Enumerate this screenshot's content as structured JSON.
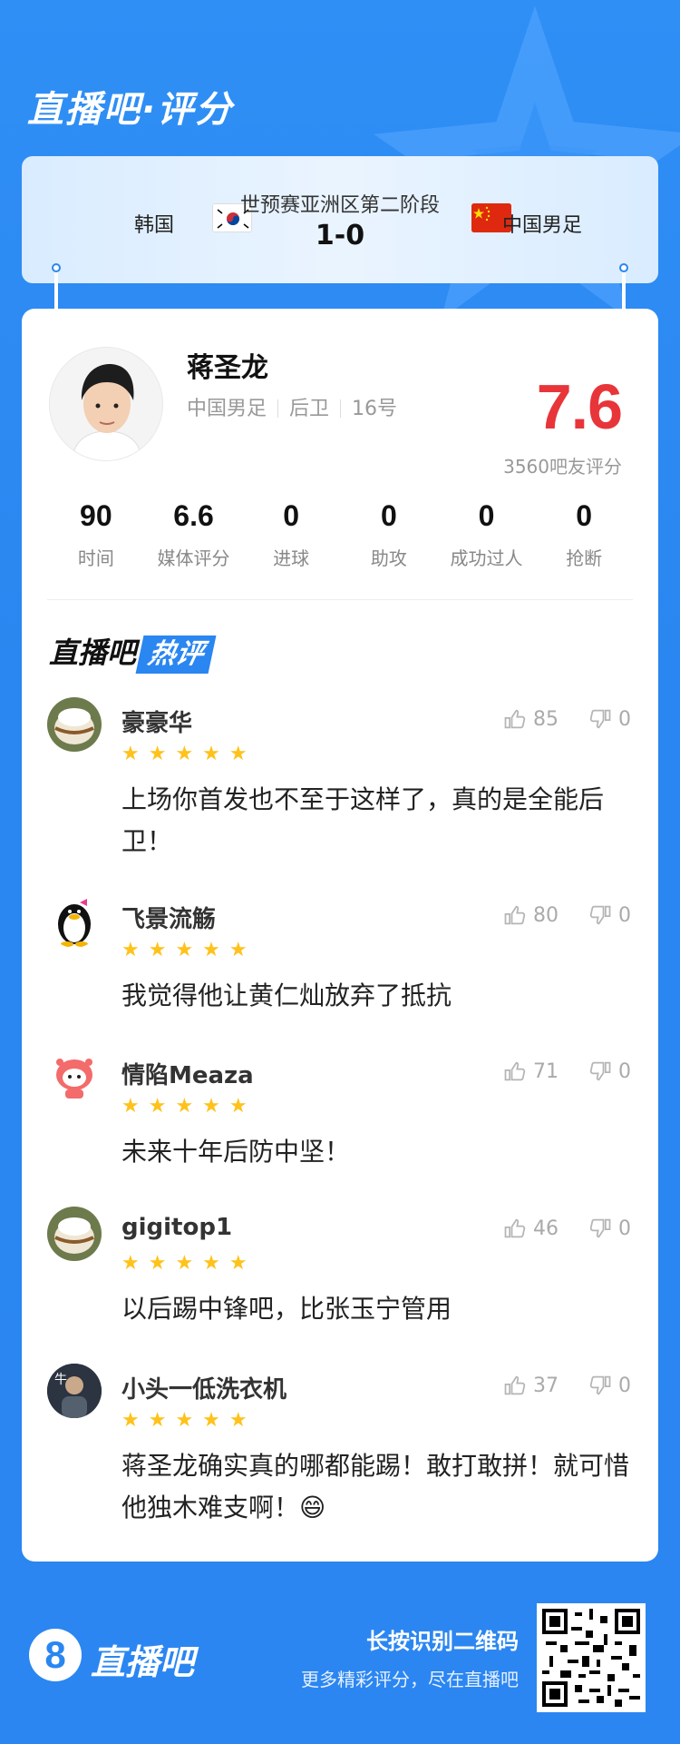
{
  "page": {
    "title": "直播吧·评分"
  },
  "match": {
    "stage": "世预赛亚洲区第二阶段",
    "score": "1-0",
    "home_team": "韩国",
    "away_team": "中国男足"
  },
  "player": {
    "name": "蒋圣龙",
    "team": "中国男足",
    "position": "后卫",
    "number": "16号",
    "rating": "7.6",
    "rating_count": "3560吧友评分"
  },
  "stats": [
    {
      "value": "90",
      "label": "时间"
    },
    {
      "value": "6.6",
      "label": "媒体评分"
    },
    {
      "value": "0",
      "label": "进球"
    },
    {
      "value": "0",
      "label": "助攻"
    },
    {
      "value": "0",
      "label": "成功过人"
    },
    {
      "value": "0",
      "label": "抢断"
    }
  ],
  "hot_comments_title": {
    "part1": "直播吧",
    "part2": "热评"
  },
  "comments": [
    {
      "name": "豪豪华",
      "stars": "★★★★★",
      "rating": 5,
      "text": "上场你首发也不至于这样了，真的是全能后卫！",
      "likes": "85",
      "dislikes": "0"
    },
    {
      "name": "飞景流觞",
      "stars": "★★★★★",
      "rating": 5,
      "text": "我觉得他让黄仁灿放弃了抵抗",
      "likes": "80",
      "dislikes": "0"
    },
    {
      "name": "情陷Meaza",
      "stars": "★★★★★",
      "rating": 5,
      "text": "未来十年后防中坚！",
      "likes": "71",
      "dislikes": "0"
    },
    {
      "name": "gigitop1",
      "stars": "★★★★★",
      "rating": 5,
      "text": "以后踢中锋吧，比张玉宁管用",
      "likes": "46",
      "dislikes": "0"
    },
    {
      "name": "小头一低洗衣机",
      "stars": "★★★★★",
      "rating": 5,
      "text": "蒋圣龙确实真的哪都能踢！敢打敢拼！就可惜他独木难支啊！😄",
      "likes": "37",
      "dislikes": "0"
    }
  ],
  "footer": {
    "logo_text": "直播吧",
    "scan_title": "长按识别二维码",
    "scan_subtitle": "更多精彩评分，尽在直播吧"
  },
  "colors": {
    "brand": "#2a86f0",
    "rating": "#e8353a",
    "star": "#ffc21b"
  }
}
